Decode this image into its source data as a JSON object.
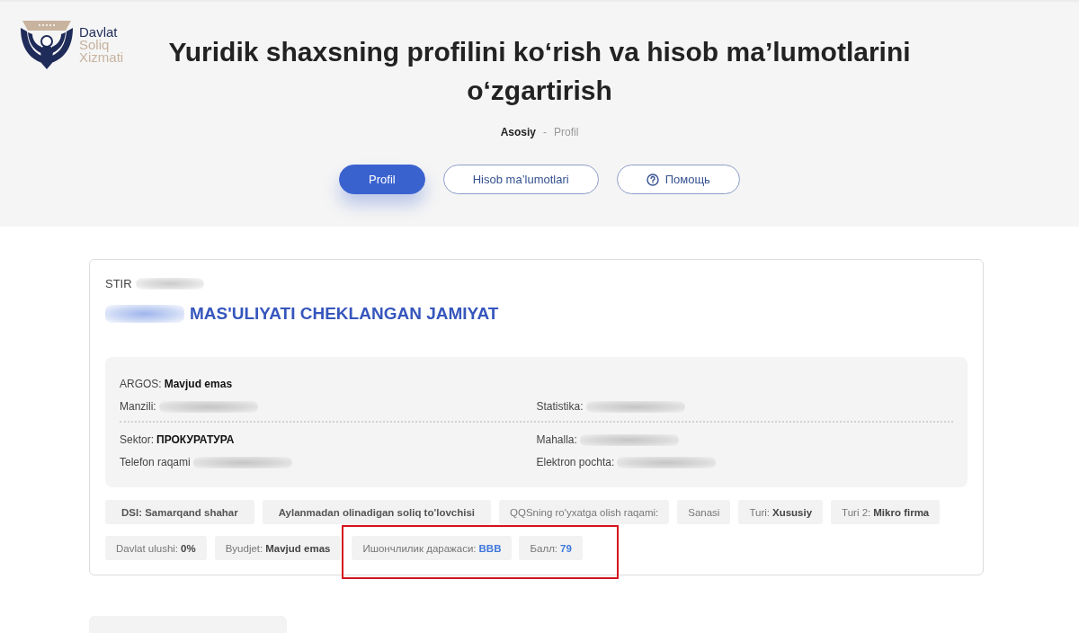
{
  "header": {
    "logo": {
      "primary": "Davlat",
      "secondary": [
        "Soliq",
        "Xizmati"
      ]
    },
    "title": "Yuridik shaxsning profilini ko‘rish va hisob ma’lumotlarini o‘zgartirish",
    "breadcrumb": {
      "separator": "-",
      "items": [
        {
          "label": "Asosiy",
          "current": false
        },
        {
          "label": "Profil",
          "current": true
        }
      ]
    },
    "tabs": [
      {
        "label": "Profil",
        "selected": true,
        "kind": "page"
      },
      {
        "label": "Hisob ma’lumotlari",
        "selected": false,
        "kind": "page"
      },
      {
        "label": "Помощь",
        "selected": false,
        "kind": "help"
      }
    ]
  },
  "company_card": {
    "stir_label": "STIR",
    "stir_redacted": true,
    "name_redacted": true,
    "name": "MAS'ULIYATI CHEKLANGAN JAMIYAT",
    "info_panel": {
      "sections": [
        {
          "rows": [
            {
              "cells": [
                {
                  "label": "ARGOS:",
                  "value": "Mavjud emas",
                  "redacted": false
                }
              ]
            },
            {
              "cells": [
                {
                  "label": "Manzili:",
                  "redacted": true
                },
                {
                  "label": "Statistika:",
                  "redacted": true
                }
              ]
            }
          ]
        },
        {
          "rows": [
            {
              "cells": [
                {
                  "label": "Sektor:",
                  "value": "ПРОКУРАТУРА",
                  "redacted": false
                },
                {
                  "label": "Mahalla:",
                  "redacted": true
                }
              ]
            },
            {
              "cells": [
                {
                  "label": "Telefon raqami",
                  "redacted": true
                },
                {
                  "label": "Elektron pochta:",
                  "redacted": true
                }
              ]
            }
          ]
        }
      ]
    },
    "tag_rows": [
      {
        "tags": [
          {
            "kind": "bold",
            "label": "DSI: Samarqand shahar",
            "highlighted": false
          },
          {
            "kind": "bold",
            "label": "Aylanmadan olinadigan soliq to'lovchisi",
            "highlighted": false
          },
          {
            "kind": "plain",
            "label": "QQSning ro'yxatga olish raqami:",
            "highlighted": false
          },
          {
            "kind": "plain",
            "label": "Sanasi",
            "highlighted": false
          },
          {
            "kind": "field",
            "label": "Turi:",
            "value": "Xususiy",
            "highlighted": false
          },
          {
            "kind": "field",
            "label": "Turi 2:",
            "value": "Mikro firma",
            "highlighted": false
          }
        ]
      },
      {
        "tags": [
          {
            "kind": "field",
            "label": "Davlat ulushi:",
            "value": "0%",
            "highlighted": false
          },
          {
            "kind": "field",
            "label": "Byudjet:",
            "value": "Mavjud emas",
            "highlighted": false
          },
          {
            "kind": "rating",
            "label": "Ишончлилик даражаси:",
            "value": "BBB",
            "highlighted": true
          },
          {
            "kind": "rating",
            "label": "Балл:",
            "value": "79",
            "highlighted": true
          }
        ]
      }
    ]
  }
}
